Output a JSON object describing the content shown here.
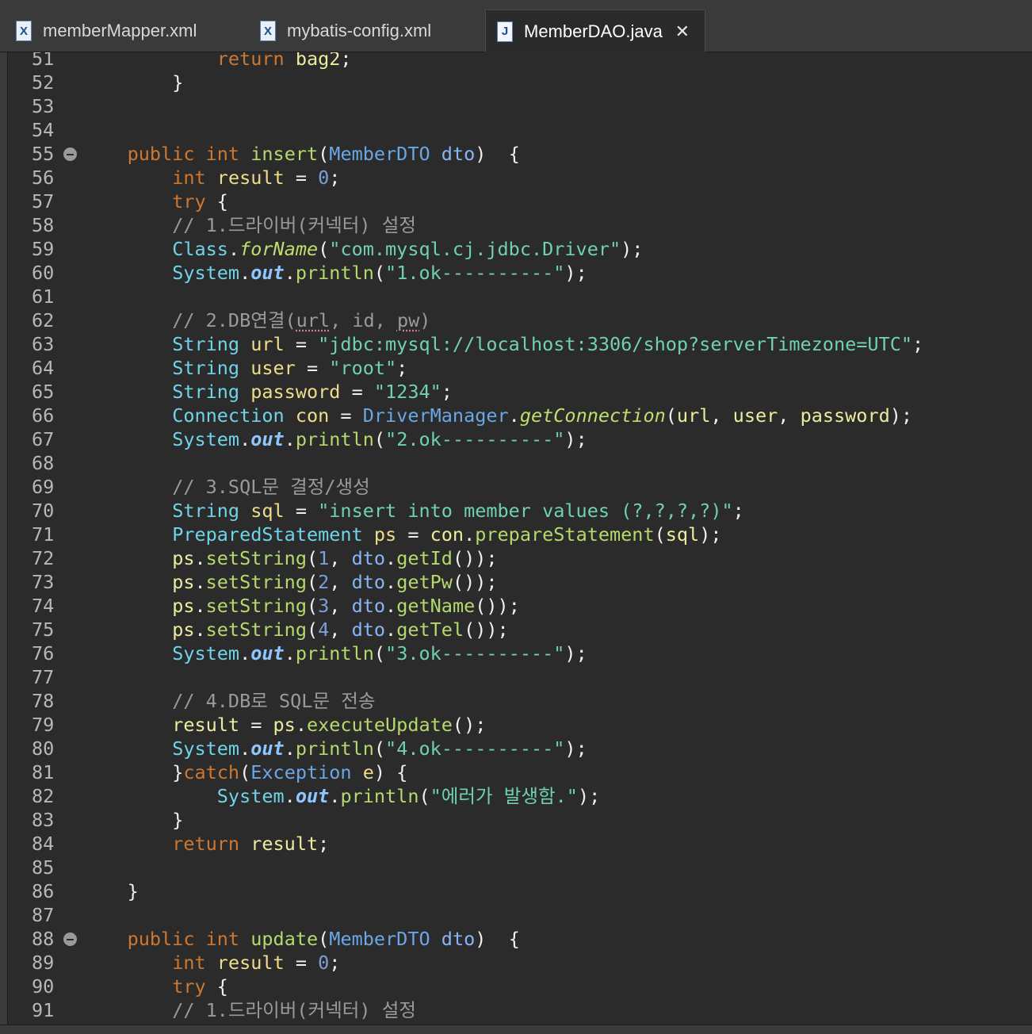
{
  "tabs": [
    {
      "label": "memberMapper.xml",
      "icon": "xml-file-icon",
      "icon_glyph": "X",
      "active": false
    },
    {
      "label": "mybatis-config.xml",
      "icon": "xml-file-icon",
      "icon_glyph": "X",
      "active": false
    },
    {
      "label": "MemberDAO.java",
      "icon": "java-file-icon",
      "icon_glyph": "J",
      "active": true
    }
  ],
  "close_glyph": "✕",
  "colors": {
    "background": "#2b2b2b",
    "keyword": "#cc7832",
    "string": "#6fd1b0",
    "comment": "#9a9a9a",
    "type": "#6aa7e6",
    "line_number": "#b8b8b8"
  },
  "code_lines": [
    {
      "n": "51",
      "tokens": [
        [
          "            ",
          ""
        ],
        [
          "return",
          "kw"
        ],
        [
          " ",
          ""
        ],
        [
          "bag2",
          "idw"
        ],
        [
          ";",
          "punc"
        ]
      ]
    },
    {
      "n": "52",
      "tokens": [
        [
          "        ",
          ""
        ],
        [
          "}",
          "punc"
        ]
      ]
    },
    {
      "n": "53",
      "tokens": []
    },
    {
      "n": "54",
      "tokens": []
    },
    {
      "n": "55",
      "fold": true,
      "tokens": [
        [
          "    ",
          ""
        ],
        [
          "public",
          "kw"
        ],
        [
          " ",
          ""
        ],
        [
          "int",
          "kw"
        ],
        [
          " ",
          ""
        ],
        [
          "insert",
          "meth"
        ],
        [
          "(",
          "punc"
        ],
        [
          "MemberDTO",
          "type"
        ],
        [
          " ",
          ""
        ],
        [
          "dto",
          "param"
        ],
        [
          ")  {",
          "punc"
        ]
      ]
    },
    {
      "n": "56",
      "tokens": [
        [
          "        ",
          ""
        ],
        [
          "int",
          "kw"
        ],
        [
          " ",
          ""
        ],
        [
          "result",
          "id"
        ],
        [
          " = ",
          "punc"
        ],
        [
          "0",
          "num"
        ],
        [
          ";",
          "punc"
        ]
      ]
    },
    {
      "n": "57",
      "tokens": [
        [
          "        ",
          ""
        ],
        [
          "try",
          "kw"
        ],
        [
          " {",
          "punc"
        ]
      ]
    },
    {
      "n": "58",
      "tokens": [
        [
          "        ",
          ""
        ],
        [
          "// 1.드라이버(커넥터) 설정",
          "cm"
        ]
      ]
    },
    {
      "n": "59",
      "tokens": [
        [
          "        ",
          ""
        ],
        [
          "Class",
          "typec"
        ],
        [
          ".",
          "punc"
        ],
        [
          "forName",
          "smeth"
        ],
        [
          "(",
          "punc"
        ],
        [
          "\"com.mysql.cj.jdbc.Driver\"",
          "str"
        ],
        [
          ");",
          "punc"
        ]
      ]
    },
    {
      "n": "60",
      "tokens": [
        [
          "        ",
          ""
        ],
        [
          "System",
          "typec"
        ],
        [
          ".",
          "punc"
        ],
        [
          "out",
          "field"
        ],
        [
          ".",
          "punc"
        ],
        [
          "println",
          "meth"
        ],
        [
          "(",
          "punc"
        ],
        [
          "\"1.ok----------\"",
          "str"
        ],
        [
          ");",
          "punc"
        ]
      ]
    },
    {
      "n": "61",
      "tokens": []
    },
    {
      "n": "62",
      "tokens": [
        [
          "        ",
          ""
        ],
        [
          "// 2.DB연결(",
          "cm"
        ],
        [
          "url",
          "cm warn"
        ],
        [
          ", id, ",
          "cm"
        ],
        [
          "pw",
          "cm warn"
        ],
        [
          ")",
          "cm"
        ]
      ]
    },
    {
      "n": "63",
      "tokens": [
        [
          "        ",
          ""
        ],
        [
          "String",
          "typec"
        ],
        [
          " ",
          ""
        ],
        [
          "url",
          "id"
        ],
        [
          " = ",
          "punc"
        ],
        [
          "\"jdbc:mysql://localhost:3306/shop?serverTimezone=UTC\"",
          "str"
        ],
        [
          ";",
          "punc"
        ]
      ]
    },
    {
      "n": "64",
      "tokens": [
        [
          "        ",
          ""
        ],
        [
          "String",
          "typec"
        ],
        [
          " ",
          ""
        ],
        [
          "user",
          "id"
        ],
        [
          " = ",
          "punc"
        ],
        [
          "\"root\"",
          "str"
        ],
        [
          ";",
          "punc"
        ]
      ]
    },
    {
      "n": "65",
      "tokens": [
        [
          "        ",
          ""
        ],
        [
          "String",
          "typec"
        ],
        [
          " ",
          ""
        ],
        [
          "password",
          "id"
        ],
        [
          " = ",
          "punc"
        ],
        [
          "\"1234\"",
          "str"
        ],
        [
          ";",
          "punc"
        ]
      ]
    },
    {
      "n": "66",
      "tokens": [
        [
          "        ",
          ""
        ],
        [
          "Connection",
          "typec"
        ],
        [
          " ",
          ""
        ],
        [
          "con",
          "id"
        ],
        [
          " = ",
          "punc"
        ],
        [
          "DriverManager",
          "type"
        ],
        [
          ".",
          "punc"
        ],
        [
          "getConnection",
          "smeth"
        ],
        [
          "(",
          "punc"
        ],
        [
          "url",
          "idw"
        ],
        [
          ", ",
          "punc"
        ],
        [
          "user",
          "idw"
        ],
        [
          ", ",
          "punc"
        ],
        [
          "password",
          "idw"
        ],
        [
          ");",
          "punc"
        ]
      ]
    },
    {
      "n": "67",
      "tokens": [
        [
          "        ",
          ""
        ],
        [
          "System",
          "typec"
        ],
        [
          ".",
          "punc"
        ],
        [
          "out",
          "field"
        ],
        [
          ".",
          "punc"
        ],
        [
          "println",
          "meth"
        ],
        [
          "(",
          "punc"
        ],
        [
          "\"2.ok----------\"",
          "str"
        ],
        [
          ");",
          "punc"
        ]
      ]
    },
    {
      "n": "68",
      "tokens": []
    },
    {
      "n": "69",
      "tokens": [
        [
          "        ",
          ""
        ],
        [
          "// 3.SQL문 결정/생성",
          "cm"
        ]
      ]
    },
    {
      "n": "70",
      "tokens": [
        [
          "        ",
          ""
        ],
        [
          "String",
          "typec"
        ],
        [
          " ",
          ""
        ],
        [
          "sql",
          "id"
        ],
        [
          " = ",
          "punc"
        ],
        [
          "\"insert into member values (?,?,?,?)\"",
          "str"
        ],
        [
          ";",
          "punc"
        ]
      ]
    },
    {
      "n": "71",
      "tokens": [
        [
          "        ",
          ""
        ],
        [
          "PreparedStatement",
          "typec"
        ],
        [
          " ",
          ""
        ],
        [
          "ps",
          "id"
        ],
        [
          " = ",
          "punc"
        ],
        [
          "con",
          "idw"
        ],
        [
          ".",
          "punc"
        ],
        [
          "prepareStatement",
          "meth"
        ],
        [
          "(",
          "punc"
        ],
        [
          "sql",
          "idw"
        ],
        [
          ");",
          "punc"
        ]
      ]
    },
    {
      "n": "72",
      "tokens": [
        [
          "        ",
          ""
        ],
        [
          "ps",
          "idw"
        ],
        [
          ".",
          "punc"
        ],
        [
          "setString",
          "meth"
        ],
        [
          "(",
          "punc"
        ],
        [
          "1",
          "num"
        ],
        [
          ", ",
          "punc"
        ],
        [
          "dto",
          "param"
        ],
        [
          ".",
          "punc"
        ],
        [
          "getId",
          "meth"
        ],
        [
          "());",
          "punc"
        ]
      ]
    },
    {
      "n": "73",
      "tokens": [
        [
          "        ",
          ""
        ],
        [
          "ps",
          "idw"
        ],
        [
          ".",
          "punc"
        ],
        [
          "setString",
          "meth"
        ],
        [
          "(",
          "punc"
        ],
        [
          "2",
          "num"
        ],
        [
          ", ",
          "punc"
        ],
        [
          "dto",
          "param"
        ],
        [
          ".",
          "punc"
        ],
        [
          "getPw",
          "meth"
        ],
        [
          "());",
          "punc"
        ]
      ]
    },
    {
      "n": "74",
      "tokens": [
        [
          "        ",
          ""
        ],
        [
          "ps",
          "idw"
        ],
        [
          ".",
          "punc"
        ],
        [
          "setString",
          "meth"
        ],
        [
          "(",
          "punc"
        ],
        [
          "3",
          "num"
        ],
        [
          ", ",
          "punc"
        ],
        [
          "dto",
          "param"
        ],
        [
          ".",
          "punc"
        ],
        [
          "getName",
          "meth"
        ],
        [
          "());",
          "punc"
        ]
      ]
    },
    {
      "n": "75",
      "tokens": [
        [
          "        ",
          ""
        ],
        [
          "ps",
          "idw"
        ],
        [
          ".",
          "punc"
        ],
        [
          "setString",
          "meth"
        ],
        [
          "(",
          "punc"
        ],
        [
          "4",
          "num"
        ],
        [
          ", ",
          "punc"
        ],
        [
          "dto",
          "param"
        ],
        [
          ".",
          "punc"
        ],
        [
          "getTel",
          "meth"
        ],
        [
          "());",
          "punc"
        ]
      ]
    },
    {
      "n": "76",
      "tokens": [
        [
          "        ",
          ""
        ],
        [
          "System",
          "typec"
        ],
        [
          ".",
          "punc"
        ],
        [
          "out",
          "field"
        ],
        [
          ".",
          "punc"
        ],
        [
          "println",
          "meth"
        ],
        [
          "(",
          "punc"
        ],
        [
          "\"3.ok----------\"",
          "str"
        ],
        [
          ");",
          "punc"
        ]
      ]
    },
    {
      "n": "77",
      "tokens": []
    },
    {
      "n": "78",
      "tokens": [
        [
          "        ",
          ""
        ],
        [
          "// 4.DB로 SQL문 전송",
          "cm"
        ]
      ]
    },
    {
      "n": "79",
      "tokens": [
        [
          "        ",
          ""
        ],
        [
          "result",
          "idw"
        ],
        [
          " = ",
          "punc"
        ],
        [
          "ps",
          "idw"
        ],
        [
          ".",
          "punc"
        ],
        [
          "executeUpdate",
          "meth"
        ],
        [
          "();",
          "punc"
        ]
      ]
    },
    {
      "n": "80",
      "tokens": [
        [
          "        ",
          ""
        ],
        [
          "System",
          "typec"
        ],
        [
          ".",
          "punc"
        ],
        [
          "out",
          "field"
        ],
        [
          ".",
          "punc"
        ],
        [
          "println",
          "meth"
        ],
        [
          "(",
          "punc"
        ],
        [
          "\"4.ok----------\"",
          "str"
        ],
        [
          ");",
          "punc"
        ]
      ]
    },
    {
      "n": "81",
      "tokens": [
        [
          "        ",
          ""
        ],
        [
          "}",
          "punc"
        ],
        [
          "catch",
          "kw"
        ],
        [
          "(",
          "punc"
        ],
        [
          "Exception",
          "type"
        ],
        [
          " ",
          ""
        ],
        [
          "e",
          "id"
        ],
        [
          ") {",
          "punc"
        ]
      ]
    },
    {
      "n": "82",
      "tokens": [
        [
          "            ",
          ""
        ],
        [
          "System",
          "typec"
        ],
        [
          ".",
          "punc"
        ],
        [
          "out",
          "field"
        ],
        [
          ".",
          "punc"
        ],
        [
          "println",
          "meth"
        ],
        [
          "(",
          "punc"
        ],
        [
          "\"에러가 발생함.\"",
          "str"
        ],
        [
          ");",
          "punc"
        ]
      ]
    },
    {
      "n": "83",
      "tokens": [
        [
          "        ",
          ""
        ],
        [
          "}",
          "punc"
        ]
      ]
    },
    {
      "n": "84",
      "tokens": [
        [
          "        ",
          ""
        ],
        [
          "return",
          "kw"
        ],
        [
          " ",
          ""
        ],
        [
          "result",
          "idw"
        ],
        [
          ";",
          "punc"
        ]
      ]
    },
    {
      "n": "85",
      "tokens": []
    },
    {
      "n": "86",
      "tokens": [
        [
          "    ",
          ""
        ],
        [
          "}",
          "punc"
        ]
      ]
    },
    {
      "n": "87",
      "tokens": []
    },
    {
      "n": "88",
      "fold": true,
      "tokens": [
        [
          "    ",
          ""
        ],
        [
          "public",
          "kw"
        ],
        [
          " ",
          ""
        ],
        [
          "int",
          "kw"
        ],
        [
          " ",
          ""
        ],
        [
          "update",
          "meth"
        ],
        [
          "(",
          "punc"
        ],
        [
          "MemberDTO",
          "type"
        ],
        [
          " ",
          ""
        ],
        [
          "dto",
          "param"
        ],
        [
          ")  {",
          "punc"
        ]
      ]
    },
    {
      "n": "89",
      "tokens": [
        [
          "        ",
          ""
        ],
        [
          "int",
          "kw"
        ],
        [
          " ",
          ""
        ],
        [
          "result",
          "id"
        ],
        [
          " = ",
          "punc"
        ],
        [
          "0",
          "num"
        ],
        [
          ";",
          "punc"
        ]
      ]
    },
    {
      "n": "90",
      "tokens": [
        [
          "        ",
          ""
        ],
        [
          "try",
          "kw"
        ],
        [
          " {",
          "punc"
        ]
      ]
    },
    {
      "n": "91",
      "tokens": [
        [
          "        ",
          ""
        ],
        [
          "// 1.드라이버(커넥터) 설정",
          "cm"
        ]
      ]
    }
  ]
}
